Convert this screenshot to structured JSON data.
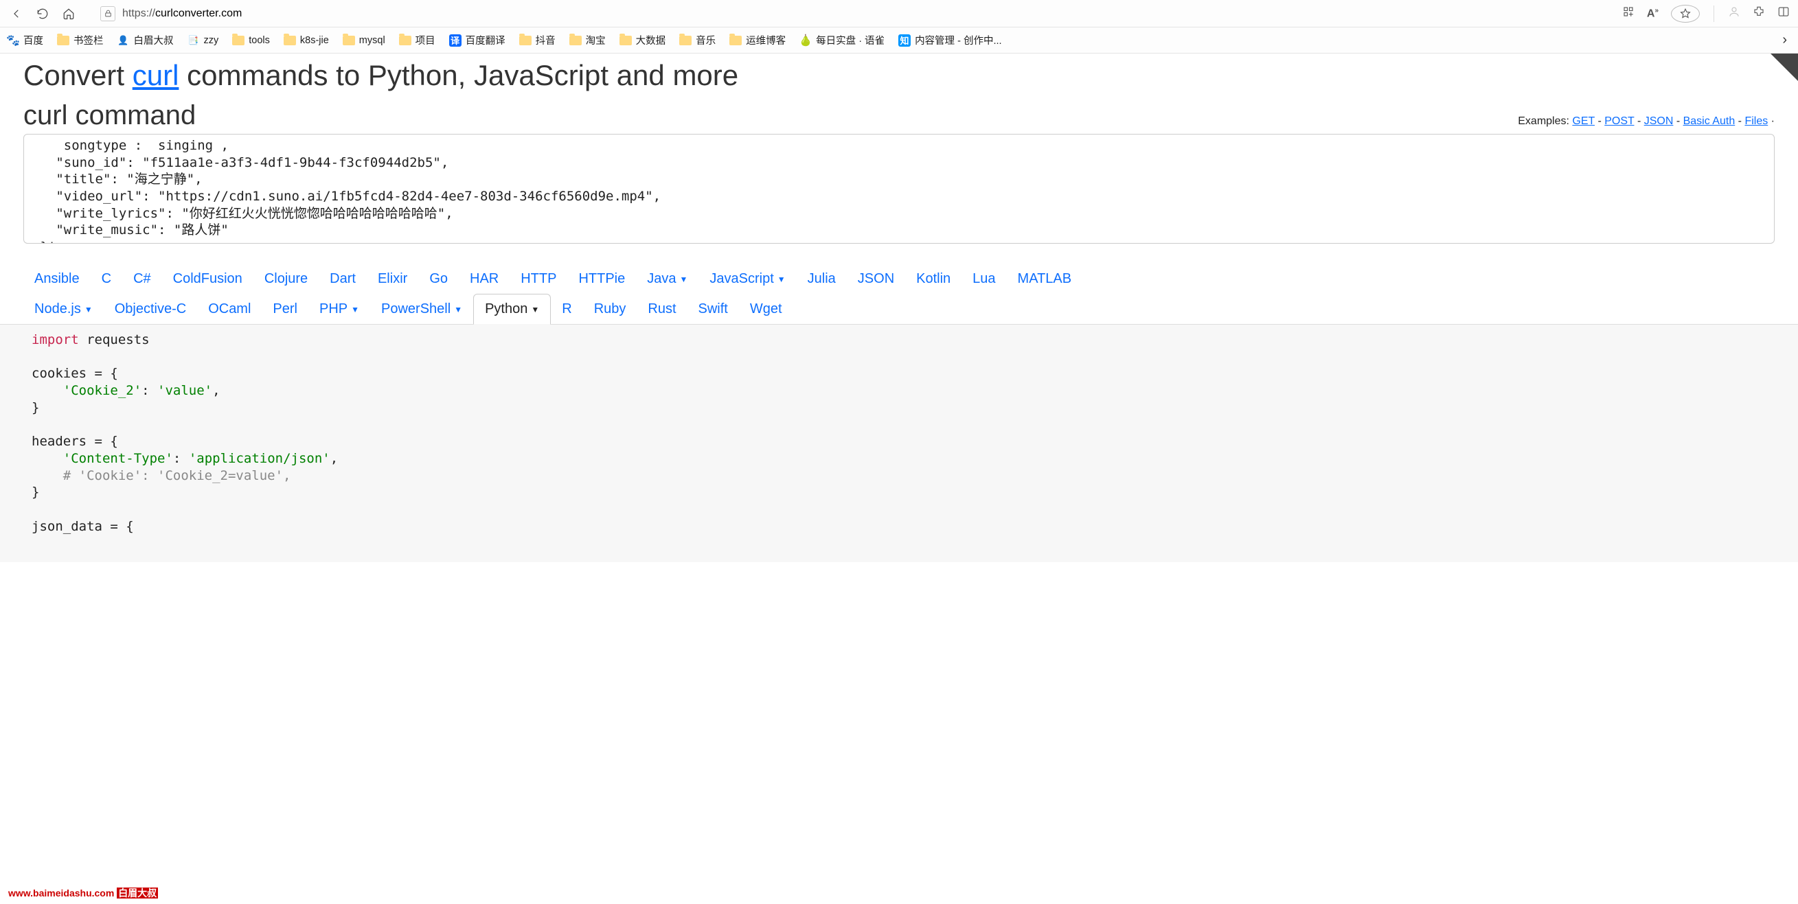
{
  "browser": {
    "url_prefix": "https://",
    "url_domain": "curlconverter.com"
  },
  "bookmarks": {
    "baidu": "百度",
    "bookmarks": "书签栏",
    "baimei": "白眉大叔",
    "zzy": "zzy",
    "tools": "tools",
    "k8s": "k8s-jie",
    "mysql": "mysql",
    "project": "项目",
    "translate": "百度翻译",
    "douyin": "抖音",
    "taobao": "淘宝",
    "bigdata": "大数据",
    "music": "音乐",
    "opsblog": "运维博客",
    "daily": "每日实盘 · 语雀",
    "content": "内容管理 - 创作中..."
  },
  "page": {
    "title_pre": "Convert ",
    "title_link": "curl",
    "title_post": " commands to Python, JavaScript and more",
    "subtitle": "curl command",
    "examples_label": "Examples: ",
    "ex_get": "GET",
    "ex_post": "POST",
    "ex_json": "JSON",
    "ex_basic": "Basic Auth",
    "ex_files": "Files",
    "sep": " - "
  },
  "curl_input": "    songtype :  singing ,\n   \"suno_id\": \"f511aa1e-a3f3-4df1-9b44-f3cf0944d2b5\",\n   \"title\": \"海之宁静\",\n   \"video_url\": \"https://cdn1.suno.ai/1fb5fcd4-82d4-4ee7-803d-346cf6560d9e.mp4\",\n   \"write_lyrics\": \"你好红红火火恍恍惚惚哈哈哈哈哈哈哈哈哈\",\n   \"write_music\": \"路人饼\"\n }'",
  "langs": {
    "ansible": "Ansible",
    "c": "C",
    "csharp": "C#",
    "coldfusion": "ColdFusion",
    "clojure": "Clojure",
    "dart": "Dart",
    "elixir": "Elixir",
    "go": "Go",
    "har": "HAR",
    "http": "HTTP",
    "httpie": "HTTPie",
    "java": "Java",
    "javascript": "JavaScript",
    "julia": "Julia",
    "json": "JSON",
    "kotlin": "Kotlin",
    "lua": "Lua",
    "matlab": "MATLAB",
    "nodejs": "Node.js",
    "objc": "Objective-C",
    "ocaml": "OCaml",
    "perl": "Perl",
    "php": "PHP",
    "powershell": "PowerShell",
    "python": "Python",
    "r": "R",
    "ruby": "Ruby",
    "rust": "Rust",
    "swift": "Swift",
    "wget": "Wget"
  },
  "output": {
    "line1_kw": "import",
    "line1_rest": " requests",
    "line3": "cookies = {",
    "line4_a": "    ",
    "line4_b": "'Cookie_2'",
    "line4_c": ": ",
    "line4_d": "'value'",
    "line4_e": ",",
    "line5": "}",
    "line7": "headers = {",
    "line8_a": "    ",
    "line8_b": "'Content-Type'",
    "line8_c": ": ",
    "line8_d": "'application/json'",
    "line8_e": ",",
    "line9_a": "    ",
    "line9_b": "# 'Cookie': 'Cookie_2=value',",
    "line10": "}",
    "line12": "json_data = {"
  },
  "watermark": {
    "url": "www.baimeidashu.com",
    "cn": "白眉大叔"
  }
}
